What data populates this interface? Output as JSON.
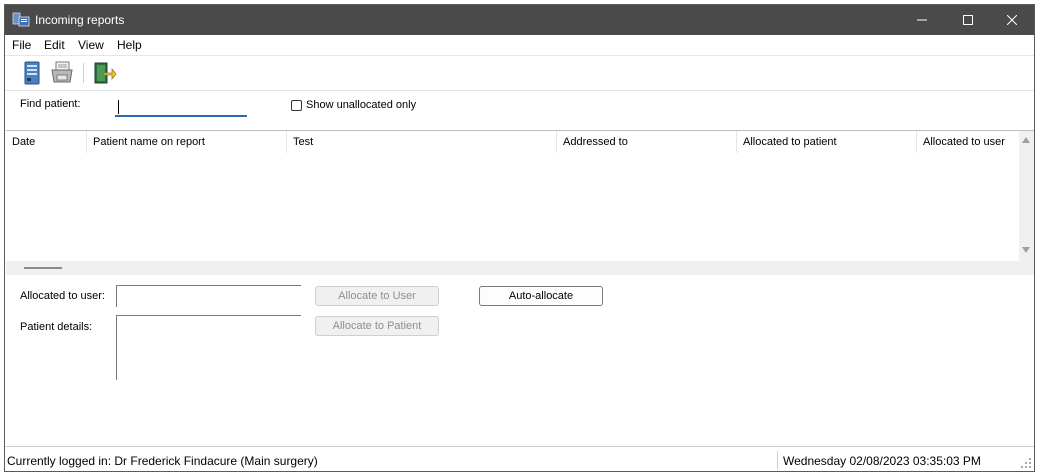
{
  "window": {
    "title": "Incoming reports",
    "controls": {
      "minimize": "—",
      "maximize": "☐",
      "close": "✕"
    }
  },
  "menubar": {
    "items": [
      "File",
      "Edit",
      "View",
      "Help"
    ]
  },
  "toolbar": {
    "buttons": [
      {
        "icon": "server-icon"
      },
      {
        "icon": "printer-icon"
      },
      {
        "icon": "exit-door-icon"
      }
    ]
  },
  "filter": {
    "find_label": "Find patient:",
    "find_value": "",
    "show_unallocated_label": "Show unallocated only",
    "show_unallocated_checked": false
  },
  "list": {
    "columns": [
      "Date",
      "Patient name on report",
      "Test",
      "Addressed to",
      "Allocated to patient",
      "Allocated to user"
    ],
    "rows": []
  },
  "allocation": {
    "allocated_to_user_label": "Allocated to user:",
    "patient_details_label": "Patient details:",
    "allocate_user_button": "Allocate to User",
    "allocate_patient_button": "Allocate to Patient",
    "auto_allocate_button": "Auto-allocate"
  },
  "status": {
    "logged_in": "Currently logged in:  Dr Frederick Findacure (Main surgery)",
    "datetime": "Wednesday 02/08/2023 03:35:03 PM"
  },
  "colors": {
    "titlebar": "#4a4a4a",
    "focus_underline": "#2b6cb0"
  }
}
